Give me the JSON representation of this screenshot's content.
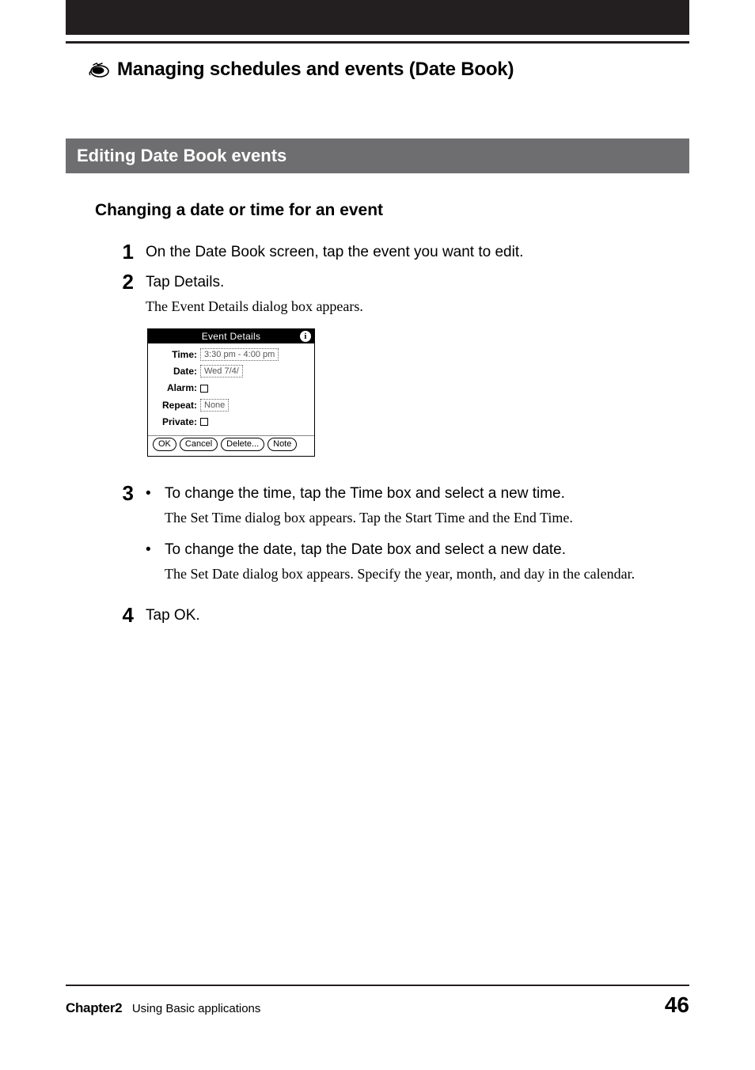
{
  "section_title": "Managing schedules and events (Date Book)",
  "banner_title": "Editing Date Book events",
  "subheading": "Changing a date or time for an event",
  "steps": {
    "n1": "1",
    "s1_text": "On the Date Book screen, tap the event you want to edit.",
    "n2": "2",
    "s2_text": "Tap Details.",
    "s2_detail": "The Event Details dialog box appears.",
    "n3": "3",
    "s3_bullet1": "To change the time, tap the Time box and select a new time.",
    "s3_bullet1_detail": "The Set Time dialog box appears. Tap the Start Time and the End Time.",
    "s3_bullet2": "To change the date, tap the Date box and select a new date.",
    "s3_bullet2_detail": "The Set Date dialog box appears. Specify the year, month, and day in the calendar.",
    "n4": "4",
    "s4_text": "Tap OK."
  },
  "dialog": {
    "title": "Event Details",
    "time_label": "Time:",
    "time_value": "3:30 pm - 4:00 pm",
    "date_label": "Date:",
    "date_value": "Wed 7/4/",
    "alarm_label": "Alarm:",
    "repeat_label": "Repeat:",
    "repeat_value": "None",
    "private_label": "Private:",
    "btn_ok": "OK",
    "btn_cancel": "Cancel",
    "btn_delete": "Delete...",
    "btn_note": "Note"
  },
  "footer": {
    "chapter": "Chapter2",
    "chapter_title": "Using Basic applications",
    "page_number": "46"
  }
}
